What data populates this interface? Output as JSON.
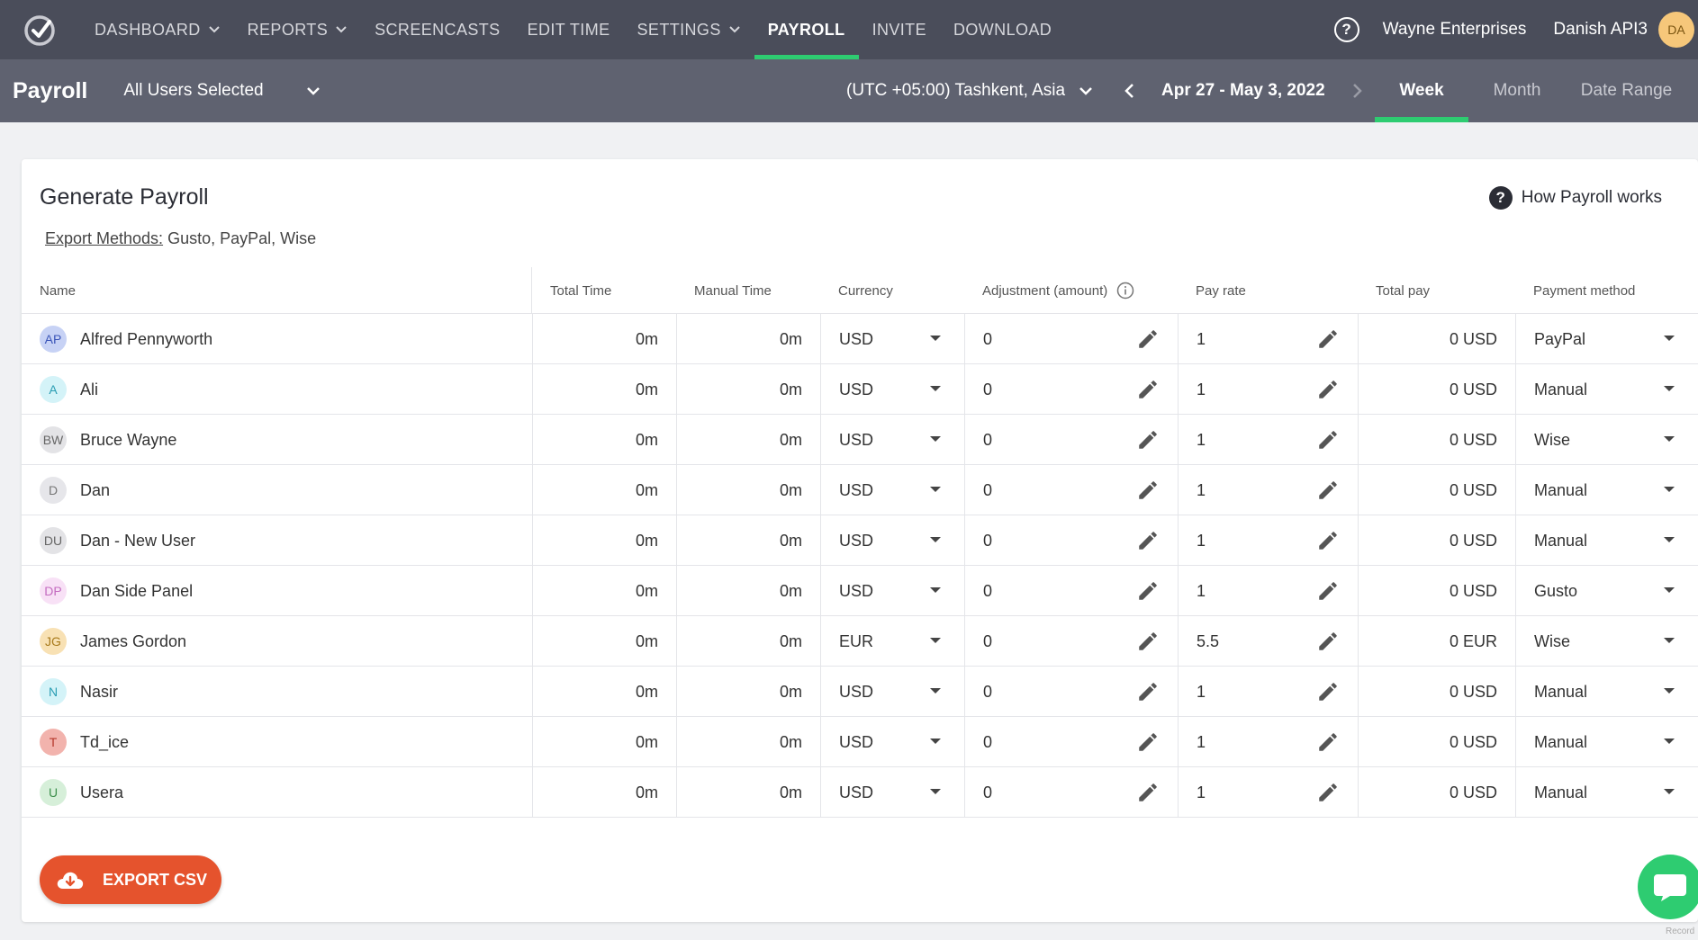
{
  "nav": {
    "items": [
      {
        "label": "DASHBOARD",
        "has_menu": true,
        "active": false
      },
      {
        "label": "REPORTS",
        "has_menu": true,
        "active": false
      },
      {
        "label": "SCREENCASTS",
        "has_menu": false,
        "active": false
      },
      {
        "label": "EDIT TIME",
        "has_menu": false,
        "active": false
      },
      {
        "label": "SETTINGS",
        "has_menu": true,
        "active": false
      },
      {
        "label": "PAYROLL",
        "has_menu": false,
        "active": true
      },
      {
        "label": "INVITE",
        "has_menu": false,
        "active": false
      },
      {
        "label": "DOWNLOAD",
        "has_menu": false,
        "active": false
      }
    ],
    "company": "Wayne Enterprises",
    "username": "Danish API3",
    "avatar_initials": "DA",
    "accent_color": "#2ecc71"
  },
  "subbar": {
    "title": "Payroll",
    "users_select": "All Users Selected",
    "timezone": "(UTC +05:00) Tashkent, Asia",
    "date_range": "Apr 27 - May 3, 2022",
    "tabs": [
      {
        "label": "Week",
        "active": true
      },
      {
        "label": "Month",
        "active": false
      },
      {
        "label": "Date Range",
        "active": false
      }
    ]
  },
  "card": {
    "title": "Generate Payroll",
    "how_link": "How Payroll works",
    "export_methods_label": "Export Methods:",
    "export_methods_value": "Gusto, PayPal, Wise",
    "export_button": "EXPORT CSV"
  },
  "table": {
    "headers": {
      "name": "Name",
      "total_time": "Total Time",
      "manual_time": "Manual Time",
      "currency": "Currency",
      "adjustment": "Adjustment (amount)",
      "pay_rate": "Pay rate",
      "total_pay": "Total pay",
      "payment_method": "Payment method"
    },
    "rows": [
      {
        "initials": "AP",
        "name": "Alfred Pennyworth",
        "total_time": "0m",
        "manual_time": "0m",
        "currency": "USD",
        "adjustment": "0",
        "pay_rate": "1",
        "total_pay": "0 USD",
        "payment_method": "PayPal",
        "avatar_bg": "#c7d2f5",
        "avatar_fg": "#3b55b8"
      },
      {
        "initials": "A",
        "name": "Ali",
        "total_time": "0m",
        "manual_time": "0m",
        "currency": "USD",
        "adjustment": "0",
        "pay_rate": "1",
        "total_pay": "0 USD",
        "payment_method": "Manual",
        "avatar_bg": "#d4f3f8",
        "avatar_fg": "#2a9db3"
      },
      {
        "initials": "BW",
        "name": "Bruce Wayne",
        "total_time": "0m",
        "manual_time": "0m",
        "currency": "USD",
        "adjustment": "0",
        "pay_rate": "1",
        "total_pay": "0 USD",
        "payment_method": "Wise",
        "avatar_bg": "#e3e3e6",
        "avatar_fg": "#666666"
      },
      {
        "initials": "D",
        "name": "Dan",
        "total_time": "0m",
        "manual_time": "0m",
        "currency": "USD",
        "adjustment": "0",
        "pay_rate": "1",
        "total_pay": "0 USD",
        "payment_method": "Manual",
        "avatar_bg": "#e6e6ea",
        "avatar_fg": "#777777"
      },
      {
        "initials": "DU",
        "name": "Dan - New User",
        "total_time": "0m",
        "manual_time": "0m",
        "currency": "USD",
        "adjustment": "0",
        "pay_rate": "1",
        "total_pay": "0 USD",
        "payment_method": "Manual",
        "avatar_bg": "#e3e3e6",
        "avatar_fg": "#666666"
      },
      {
        "initials": "DP",
        "name": "Dan Side Panel",
        "total_time": "0m",
        "manual_time": "0m",
        "currency": "USD",
        "adjustment": "0",
        "pay_rate": "1",
        "total_pay": "0 USD",
        "payment_method": "Gusto",
        "avatar_bg": "#f8e1f6",
        "avatar_fg": "#c46cc0"
      },
      {
        "initials": "JG",
        "name": "James Gordon",
        "total_time": "0m",
        "manual_time": "0m",
        "currency": "EUR",
        "adjustment": "0",
        "pay_rate": "5.5",
        "total_pay": "0 EUR",
        "payment_method": "Wise",
        "avatar_bg": "#f8e1b4",
        "avatar_fg": "#a87a1c"
      },
      {
        "initials": "N",
        "name": "Nasir",
        "total_time": "0m",
        "manual_time": "0m",
        "currency": "USD",
        "adjustment": "0",
        "pay_rate": "1",
        "total_pay": "0 USD",
        "payment_method": "Manual",
        "avatar_bg": "#d4f3f8",
        "avatar_fg": "#2a9db3"
      },
      {
        "initials": "T",
        "name": "Td_ice",
        "total_time": "0m",
        "manual_time": "0m",
        "currency": "USD",
        "adjustment": "0",
        "pay_rate": "1",
        "total_pay": "0 USD",
        "payment_method": "Manual",
        "avatar_bg": "#f2b3ad",
        "avatar_fg": "#b5372b"
      },
      {
        "initials": "U",
        "name": "Usera",
        "total_time": "0m",
        "manual_time": "0m",
        "currency": "USD",
        "adjustment": "0",
        "pay_rate": "1",
        "total_pay": "0 USD",
        "payment_method": "Manual",
        "avatar_bg": "#d6efd9",
        "avatar_fg": "#3c8f4b"
      }
    ]
  },
  "footer": {
    "record_label": "Record"
  }
}
